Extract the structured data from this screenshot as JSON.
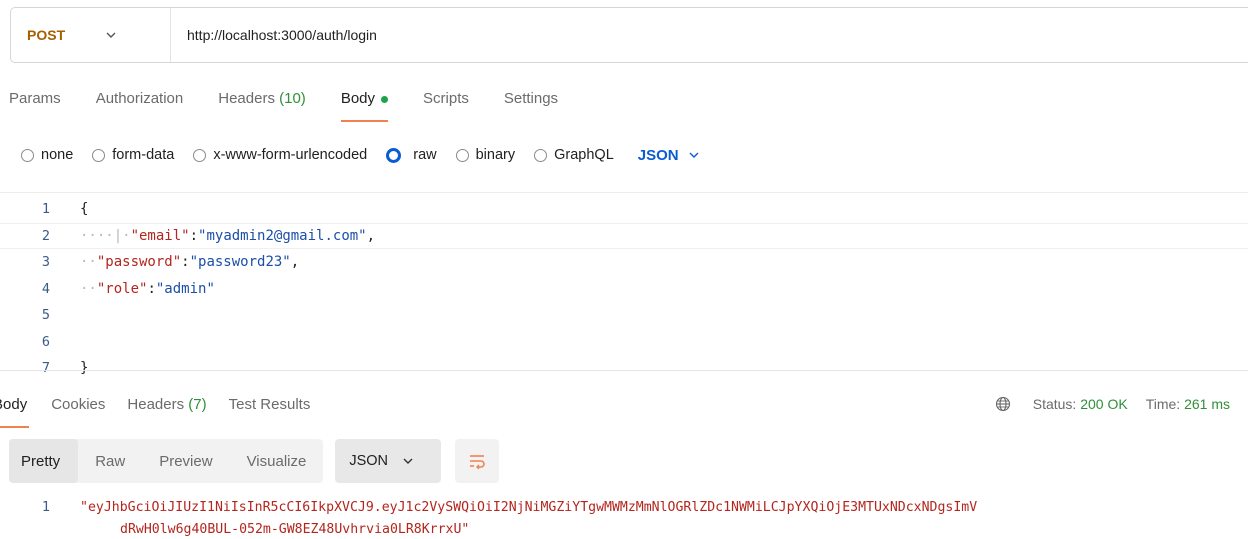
{
  "request": {
    "method": "POST",
    "url": "http://localhost:3000/auth/login"
  },
  "request_tabs": [
    {
      "label": "Params"
    },
    {
      "label": "Authorization"
    },
    {
      "label": "Headers",
      "count": "(10)"
    },
    {
      "label": "Body",
      "active": true
    },
    {
      "label": "Scripts"
    },
    {
      "label": "Settings"
    }
  ],
  "body_options": {
    "none": "none",
    "form_data": "form-data",
    "urlencoded": "x-www-form-urlencoded",
    "raw": "raw",
    "binary": "binary",
    "graphql": "GraphQL",
    "format": "JSON",
    "selected": "raw"
  },
  "editor": {
    "line_numbers": [
      "1",
      "2",
      "3",
      "4",
      "5",
      "6",
      "7"
    ],
    "open_brace": "{",
    "close_brace": "}",
    "email_key": "\"email\"",
    "email_value": "\"myadmin2@gmail.com\"",
    "password_key": "\"password\"",
    "password_value": "\"password23\"",
    "role_key": "\"role\"",
    "role_value": "\"admin\""
  },
  "response_tabs": [
    {
      "label": "Body",
      "active": true
    },
    {
      "label": "Cookies"
    },
    {
      "label": "Headers",
      "count": "(7)"
    },
    {
      "label": "Test Results"
    }
  ],
  "status": {
    "status_label": "Status:",
    "status_value": "200 OK",
    "time_label": "Time:",
    "time_value": "261 ms"
  },
  "response_view": {
    "modes": [
      "Pretty",
      "Raw",
      "Preview",
      "Visualize"
    ],
    "active": "Pretty",
    "format": "JSON"
  },
  "response_body": {
    "line_number": "1",
    "line1": "\"eyJhbGciOiJIUzI1NiIsInR5cCI6IkpXVCJ9.eyJ1c2VySWQiOiI2NjNiMGZiYTgwMWMzMmNlOGRlZDc1NWMiLCJpYXQiOjE3MTUxNDcxNDgsImV",
    "line2": "dRwH0lw6g40BUL-052m-GW8EZ48Uvhrvia0LR8KrrxU\""
  },
  "colors": {
    "method": "#a65f00",
    "accent_tab": "#f08250",
    "status_ok": "#2f8f3a",
    "json_key": "#b3261e",
    "json_string": "#1c4fa8",
    "link_blue": "#0b5bd3"
  }
}
